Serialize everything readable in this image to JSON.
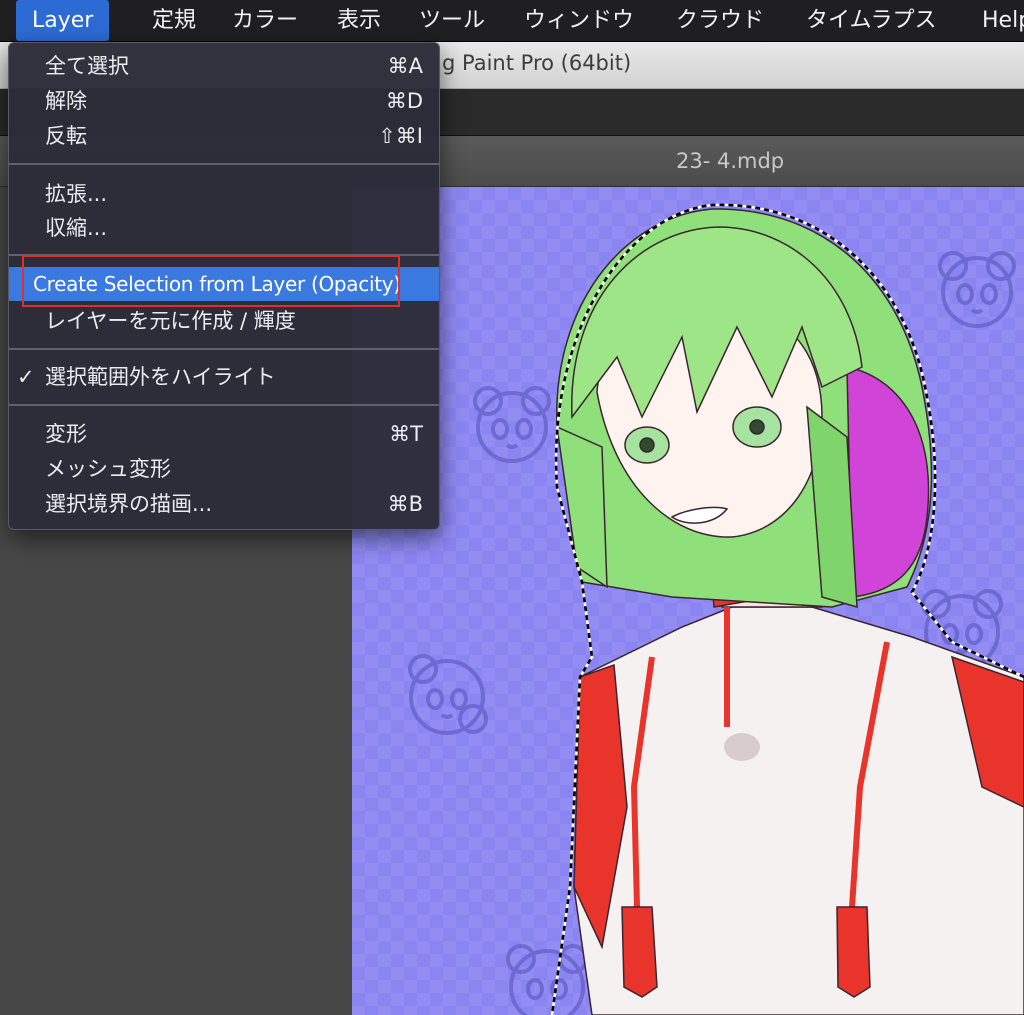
{
  "menubar": {
    "items": [
      "Layer",
      "定規",
      "カラー",
      "表示",
      "ツール",
      "ウィンドウ",
      "クラウド",
      "タイムラプス",
      "Help"
    ]
  },
  "window": {
    "title": "g Paint Pro (64bit)",
    "document_tab": "23- 4.mdp"
  },
  "dropdown": {
    "items": [
      {
        "label": "全て選択",
        "shortcut": "⌘A"
      },
      {
        "label": "解除",
        "shortcut": "⌘D"
      },
      {
        "label": "反転",
        "shortcut": "⇧⌘I"
      },
      {
        "label": "拡張...",
        "shortcut": ""
      },
      {
        "label": "収縮...",
        "shortcut": ""
      },
      {
        "label": "Create Selection from Layer (Opacity)",
        "shortcut": "",
        "highlighted": true
      },
      {
        "label": "レイヤーを元に作成 / 輝度",
        "shortcut": ""
      },
      {
        "label": "選択範囲外をハイライト",
        "shortcut": "",
        "checked": true,
        "check": "✓"
      },
      {
        "label": "変形",
        "shortcut": "⌘T"
      },
      {
        "label": "メッシュ変形",
        "shortcut": ""
      },
      {
        "label": "選択境界の描画...",
        "shortcut": "⌘B"
      }
    ]
  },
  "colors": {
    "menubar_bg": "#1f1f21",
    "active_menu": "#2d6bd4",
    "highlight": "#3a7ae0",
    "annotation_box": "#d8332b",
    "canvas_bg": "#8b85f2",
    "hair_green": "#8fe07a",
    "hair_magenta": "#d044d8",
    "accent_red": "#e8332b"
  },
  "icons": [
    "check-mark-icon"
  ]
}
